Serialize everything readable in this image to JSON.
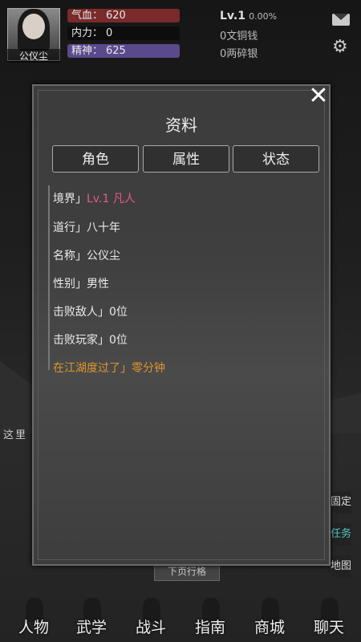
{
  "player": {
    "name": "公仪尘",
    "hp_label": "气血：",
    "hp_value": "620",
    "mp_label": "内力：",
    "mp_value": "0",
    "sp_label": "精神：",
    "sp_value": "625",
    "level": "Lv.1",
    "exp_pct": "0.00%",
    "copper": "0文铜钱",
    "silver": "0两碎银"
  },
  "background": {
    "text": "这里",
    "side_buttons": [
      "固定",
      "任务",
      "地图"
    ],
    "hidden_button": "下页行格"
  },
  "modal": {
    "title": "资料",
    "tabs": [
      "角色",
      "属性",
      "状态"
    ],
    "rows": [
      {
        "label": "境界」",
        "value": "Lv.1  凡人"
      },
      {
        "label": "道行」",
        "value": "八十年"
      },
      {
        "label": "名称」",
        "value": "公仪尘"
      },
      {
        "label": "性别」",
        "value": "男性"
      },
      {
        "label": "击败敌人」",
        "value": "0位"
      },
      {
        "label": "击败玩家」",
        "value": "0位"
      },
      {
        "label": "在江湖度过了」",
        "value": "零分钟"
      }
    ]
  },
  "nav": {
    "items": [
      "人物",
      "武学",
      "战斗",
      "指南",
      "商城",
      "聊天"
    ]
  },
  "colors": {
    "hp_bar": "#7a2a2a",
    "sp_bar": "#5a4a8c",
    "realm_value": "#e45a8a",
    "time_row": "#e0952c"
  }
}
